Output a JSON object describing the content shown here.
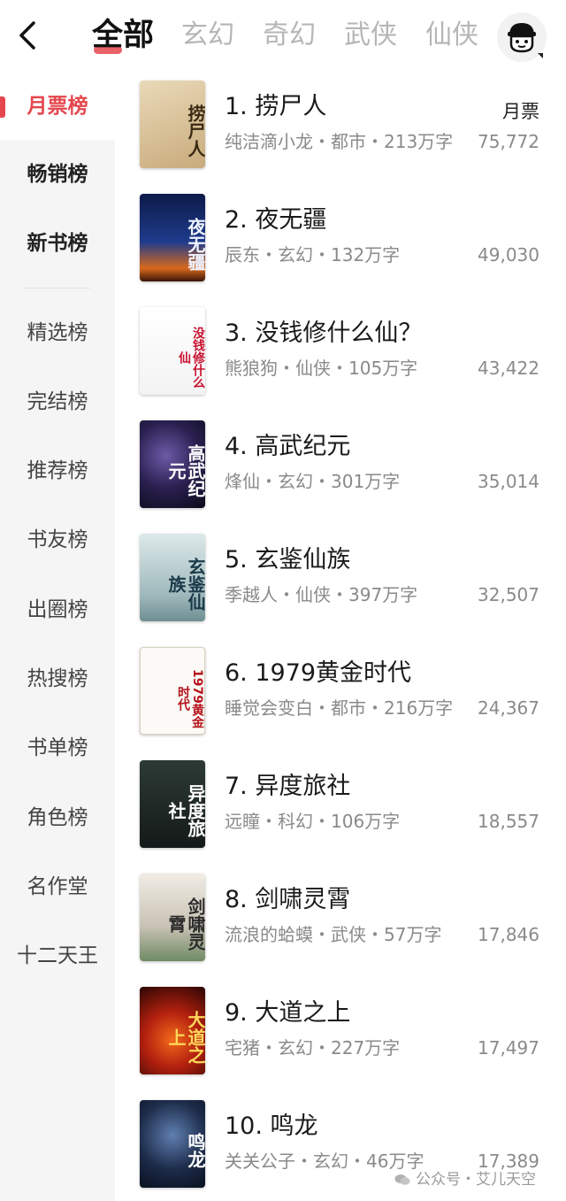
{
  "tabs": [
    "全部",
    "玄幻",
    "奇幻",
    "武侠",
    "仙侠"
  ],
  "sidebar": {
    "items": [
      "月票榜",
      "畅销榜",
      "新书榜",
      "精选榜",
      "完结榜",
      "推荐榜",
      "书友榜",
      "出圈榜",
      "热搜榜",
      "书单榜",
      "角色榜",
      "名作堂",
      "十二天王"
    ]
  },
  "list": {
    "column_label": "月票",
    "books": [
      {
        "title": "1. 捞尸人",
        "meta": "纯洁滴小龙・都市・213万字",
        "votes": "75,772",
        "cover_text": "捞尸人"
      },
      {
        "title": "2. 夜无疆",
        "meta": "辰东・玄幻・132万字",
        "votes": "49,030",
        "cover_text": "夜无疆"
      },
      {
        "title": "3. 没钱修什么仙？",
        "meta": "熊狼狗・仙侠・105万字",
        "votes": "43,422",
        "cover_text": "没钱修什么仙"
      },
      {
        "title": "4. 高武纪元",
        "meta": "烽仙・玄幻・301万字",
        "votes": "35,014",
        "cover_text": "高武纪元"
      },
      {
        "title": "5. 玄鉴仙族",
        "meta": "季越人・仙侠・397万字",
        "votes": "32,507",
        "cover_text": "玄鉴仙族"
      },
      {
        "title": "6. 1979黄金时代",
        "meta": "睡觉会变白・都市・216万字",
        "votes": "24,367",
        "cover_text": "1979黄金时代"
      },
      {
        "title": "7. 异度旅社",
        "meta": "远瞳・科幻・106万字",
        "votes": "18,557",
        "cover_text": "异度旅社"
      },
      {
        "title": "8. 剑啸灵霄",
        "meta": "流浪的蛤蟆・武侠・57万字",
        "votes": "17,846",
        "cover_text": "剑啸灵霄"
      },
      {
        "title": "9. 大道之上",
        "meta": "宅猪・玄幻・227万字",
        "votes": "17,497",
        "cover_text": "大道之上"
      },
      {
        "title": "10. 鸣龙",
        "meta": "关关公子・玄幻・46万字",
        "votes": "17,389",
        "cover_text": "鸣龙"
      }
    ]
  },
  "watermark": "公众号・艾儿天空",
  "icons": {
    "back": "chevron-left-icon",
    "avatar": "user-avatar-icon",
    "watermark": "wechat-icon"
  },
  "colors": {
    "accent": "#e5474e",
    "sidebar_bg": "#f5f5f5",
    "meta_text": "#8a8a8a",
    "inactive_tab": "#b6b6b6"
  }
}
